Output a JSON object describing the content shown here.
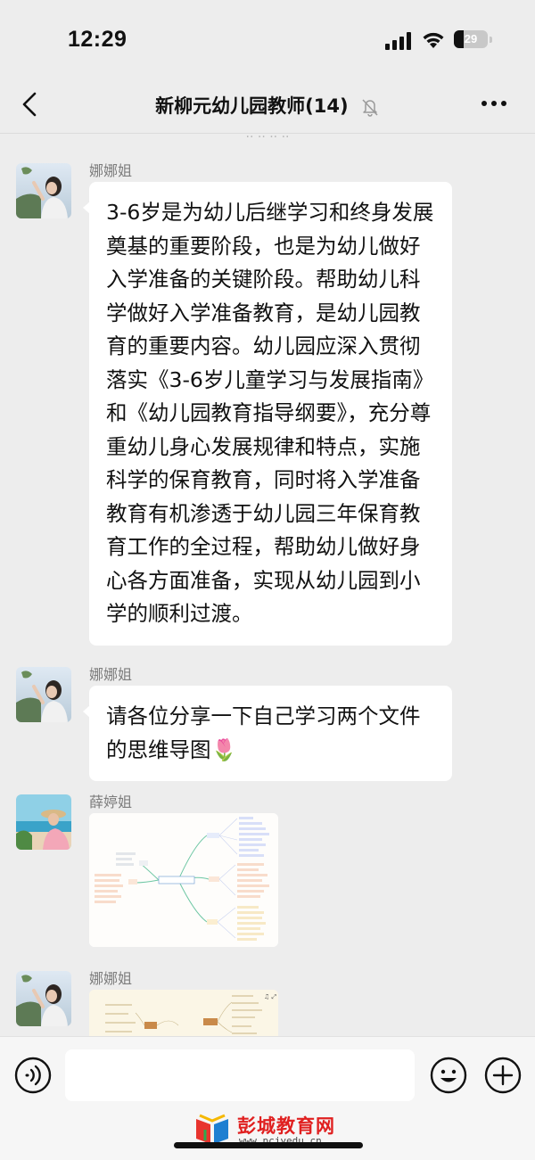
{
  "status_bar": {
    "time": "12:29",
    "battery": "29"
  },
  "nav": {
    "title": "新柳元幼儿园教师(14)"
  },
  "messages": [
    {
      "sender": "娜娜姐",
      "text": "3-6岁是为幼儿后继学习和终身发展奠基的重要阶段，也是为幼儿做好入学准备的关键阶段。帮助幼儿科学做好入学准备教育，是幼儿园教育的重要内容。幼儿园应深入贯彻落实《3-6岁儿童学习与发展指南》和《幼儿园教育指导纲要》，充分尊重幼儿身心发展规律和特点，实施科学的保育教育，同时将入学准备教育有机渗透于幼儿园三年保育教育工作的全过程，帮助幼儿做好身心各方面准备，实现从幼儿园到小学的顺利过渡。"
    },
    {
      "sender": "娜娜姐",
      "text": "请各位分享一下自己学习两个文件的思维导图🌷"
    },
    {
      "sender": "薛婷姐",
      "image": "mind-map"
    },
    {
      "sender": "娜娜姐",
      "image": "mind-map"
    }
  ],
  "watermark": {
    "title": "彭城教育网",
    "url": "www.pcjyedu.cn"
  },
  "colors": {
    "accent_red": "#e02020",
    "background": "#ededed",
    "bubble": "#ffffff"
  }
}
